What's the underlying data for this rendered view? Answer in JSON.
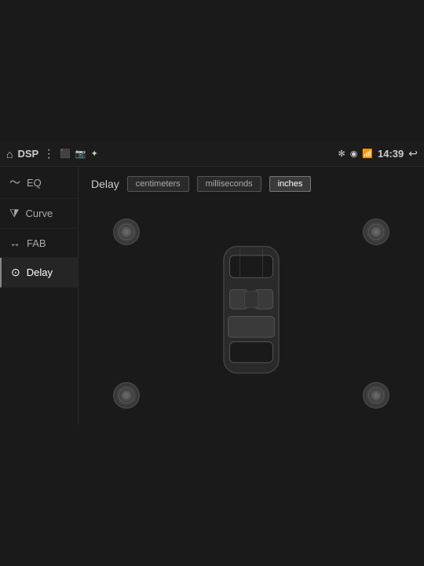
{
  "statusBar": {
    "appName": "DSP",
    "time": "14:39"
  },
  "sidebar": {
    "items": [
      {
        "id": "eq",
        "label": "EQ",
        "icon": "~"
      },
      {
        "id": "curve",
        "label": "Curve",
        "icon": "≡"
      },
      {
        "id": "fab",
        "label": "FAB",
        "icon": "↔"
      },
      {
        "id": "delay",
        "label": "Delay",
        "icon": "⊙",
        "active": true
      }
    ]
  },
  "content": {
    "title": "Delay",
    "tabs": [
      {
        "id": "centimeters",
        "label": "centimeters",
        "active": false
      },
      {
        "id": "milliseconds",
        "label": "milliseconds",
        "active": false
      },
      {
        "id": "inches",
        "label": "inches",
        "active": true
      }
    ],
    "speakers": [
      {
        "id": "front-left",
        "position": "fl"
      },
      {
        "id": "front-right",
        "position": "fr"
      },
      {
        "id": "rear-left",
        "position": "rl"
      },
      {
        "id": "rear-right",
        "position": "rr"
      }
    ]
  }
}
